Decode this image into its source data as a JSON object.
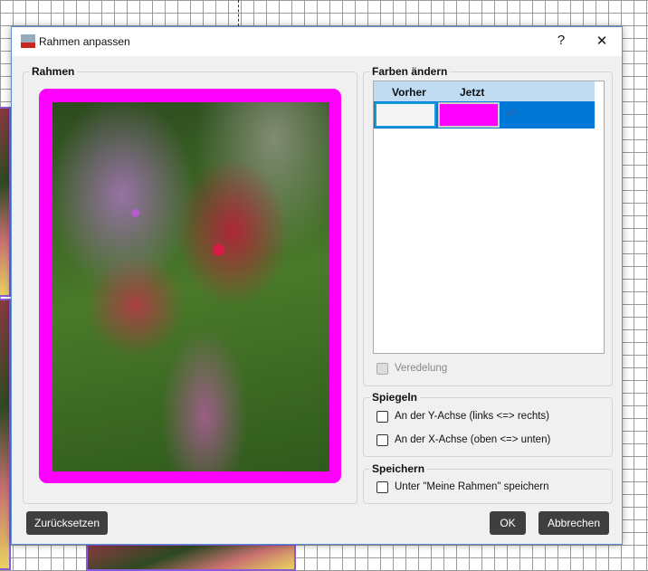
{
  "window": {
    "title": "Rahmen anpassen",
    "help": "?",
    "close": "✕"
  },
  "rahmen": {
    "label": "Rahmen"
  },
  "farben": {
    "label": "Farben ändern",
    "col_before": "Vorher",
    "col_now": "Jetzt",
    "row": {
      "before_color": "#f5f5f5",
      "now_color": "#ff00ff"
    },
    "veredelung": "Veredelung"
  },
  "spiegeln": {
    "label": "Spiegeln",
    "y_axis": "An der Y-Achse (links <=> rechts)",
    "x_axis": "An der X-Achse (oben <=> unten)"
  },
  "speichern": {
    "label": "Speichern",
    "save": "Unter \"Meine Rahmen\" speichern"
  },
  "buttons": {
    "reset": "Zurücksetzen",
    "ok": "OK",
    "cancel": "Abbrechen"
  }
}
